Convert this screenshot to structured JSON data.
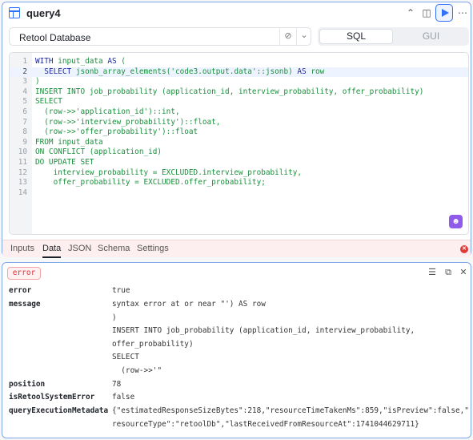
{
  "query": {
    "title": "query4",
    "icons": {
      "table": "table-icon",
      "preview": "preview-panel-icon",
      "run": "play-icon",
      "more": "more-icon"
    }
  },
  "resource": {
    "label": "Retool Database"
  },
  "mode_tabs": {
    "sql": "SQL",
    "gui": "GUI"
  },
  "editor": {
    "lines": [
      {
        "n": "1",
        "parts": [
          {
            "t": "WITH",
            "k": true
          },
          {
            "t": " input_data "
          },
          {
            "t": "AS",
            "k": true
          },
          {
            "t": " ("
          }
        ]
      },
      {
        "n": "2",
        "parts": [
          {
            "t": "  "
          },
          {
            "t": "SELECT",
            "k": true
          },
          {
            "t": " jsonb_array_elements('code3.output.data'::jsonb) "
          },
          {
            "t": "AS",
            "k": true
          },
          {
            "t": " row"
          }
        ]
      },
      {
        "n": "3",
        "parts": [
          {
            "t": ")"
          }
        ]
      },
      {
        "n": "4",
        "parts": [
          {
            "t": "INSERT INTO job_probability (application_id, interview_probability, offer_probability)"
          }
        ]
      },
      {
        "n": "5",
        "parts": [
          {
            "t": "SELECT"
          }
        ]
      },
      {
        "n": "6",
        "parts": [
          {
            "t": "  (row->>'application_id')::int,"
          }
        ]
      },
      {
        "n": "7",
        "parts": [
          {
            "t": "  (row->>'interview_probability')::float,"
          }
        ]
      },
      {
        "n": "8",
        "parts": [
          {
            "t": "  (row->>'offer_probability')::float"
          }
        ]
      },
      {
        "n": "9",
        "parts": [
          {
            "t": "FROM input_data"
          }
        ]
      },
      {
        "n": "10",
        "parts": [
          {
            "t": "ON CONFLICT (application_id)"
          }
        ]
      },
      {
        "n": "11",
        "parts": [
          {
            "t": "DO UPDATE SET"
          }
        ]
      },
      {
        "n": "12",
        "parts": [
          {
            "t": "    interview_probability = EXCLUDED.interview_probability,"
          }
        ]
      },
      {
        "n": "13",
        "parts": [
          {
            "t": "    offer_probability = EXCLUDED.offer_probability;"
          }
        ]
      },
      {
        "n": "14",
        "parts": [
          {
            "t": ""
          }
        ]
      }
    ]
  },
  "bottom_tabs": [
    "Inputs",
    "Data",
    "JSON",
    "Schema",
    "Settings"
  ],
  "result": {
    "badge": "error",
    "rows": [
      {
        "key": "error",
        "value": "true"
      },
      {
        "key": "message",
        "value": "syntax error at or near \"') AS row\n)\nINSERT INTO job_probability (application_id, interview_probability,\noffer_probability)\nSELECT\n  (row->>'\""
      },
      {
        "key": "position",
        "value": "78"
      },
      {
        "key": "isRetoolSystemError",
        "value": "false"
      },
      {
        "key": "queryExecutionMetadata",
        "value": "{\"estimatedResponseSizeBytes\":218,\"resourceTimeTakenMs\":859,\"isPreview\":false,\"\nresourceType\":\"retoolDb\",\"lastReceivedFromResourceAt\":1741044629711}"
      }
    ]
  },
  "colors": {
    "accent": "#3170f9",
    "error": "#e03b3b",
    "sql_string": "#1a8f3c",
    "sql_keyword": "#1f2a9e"
  }
}
